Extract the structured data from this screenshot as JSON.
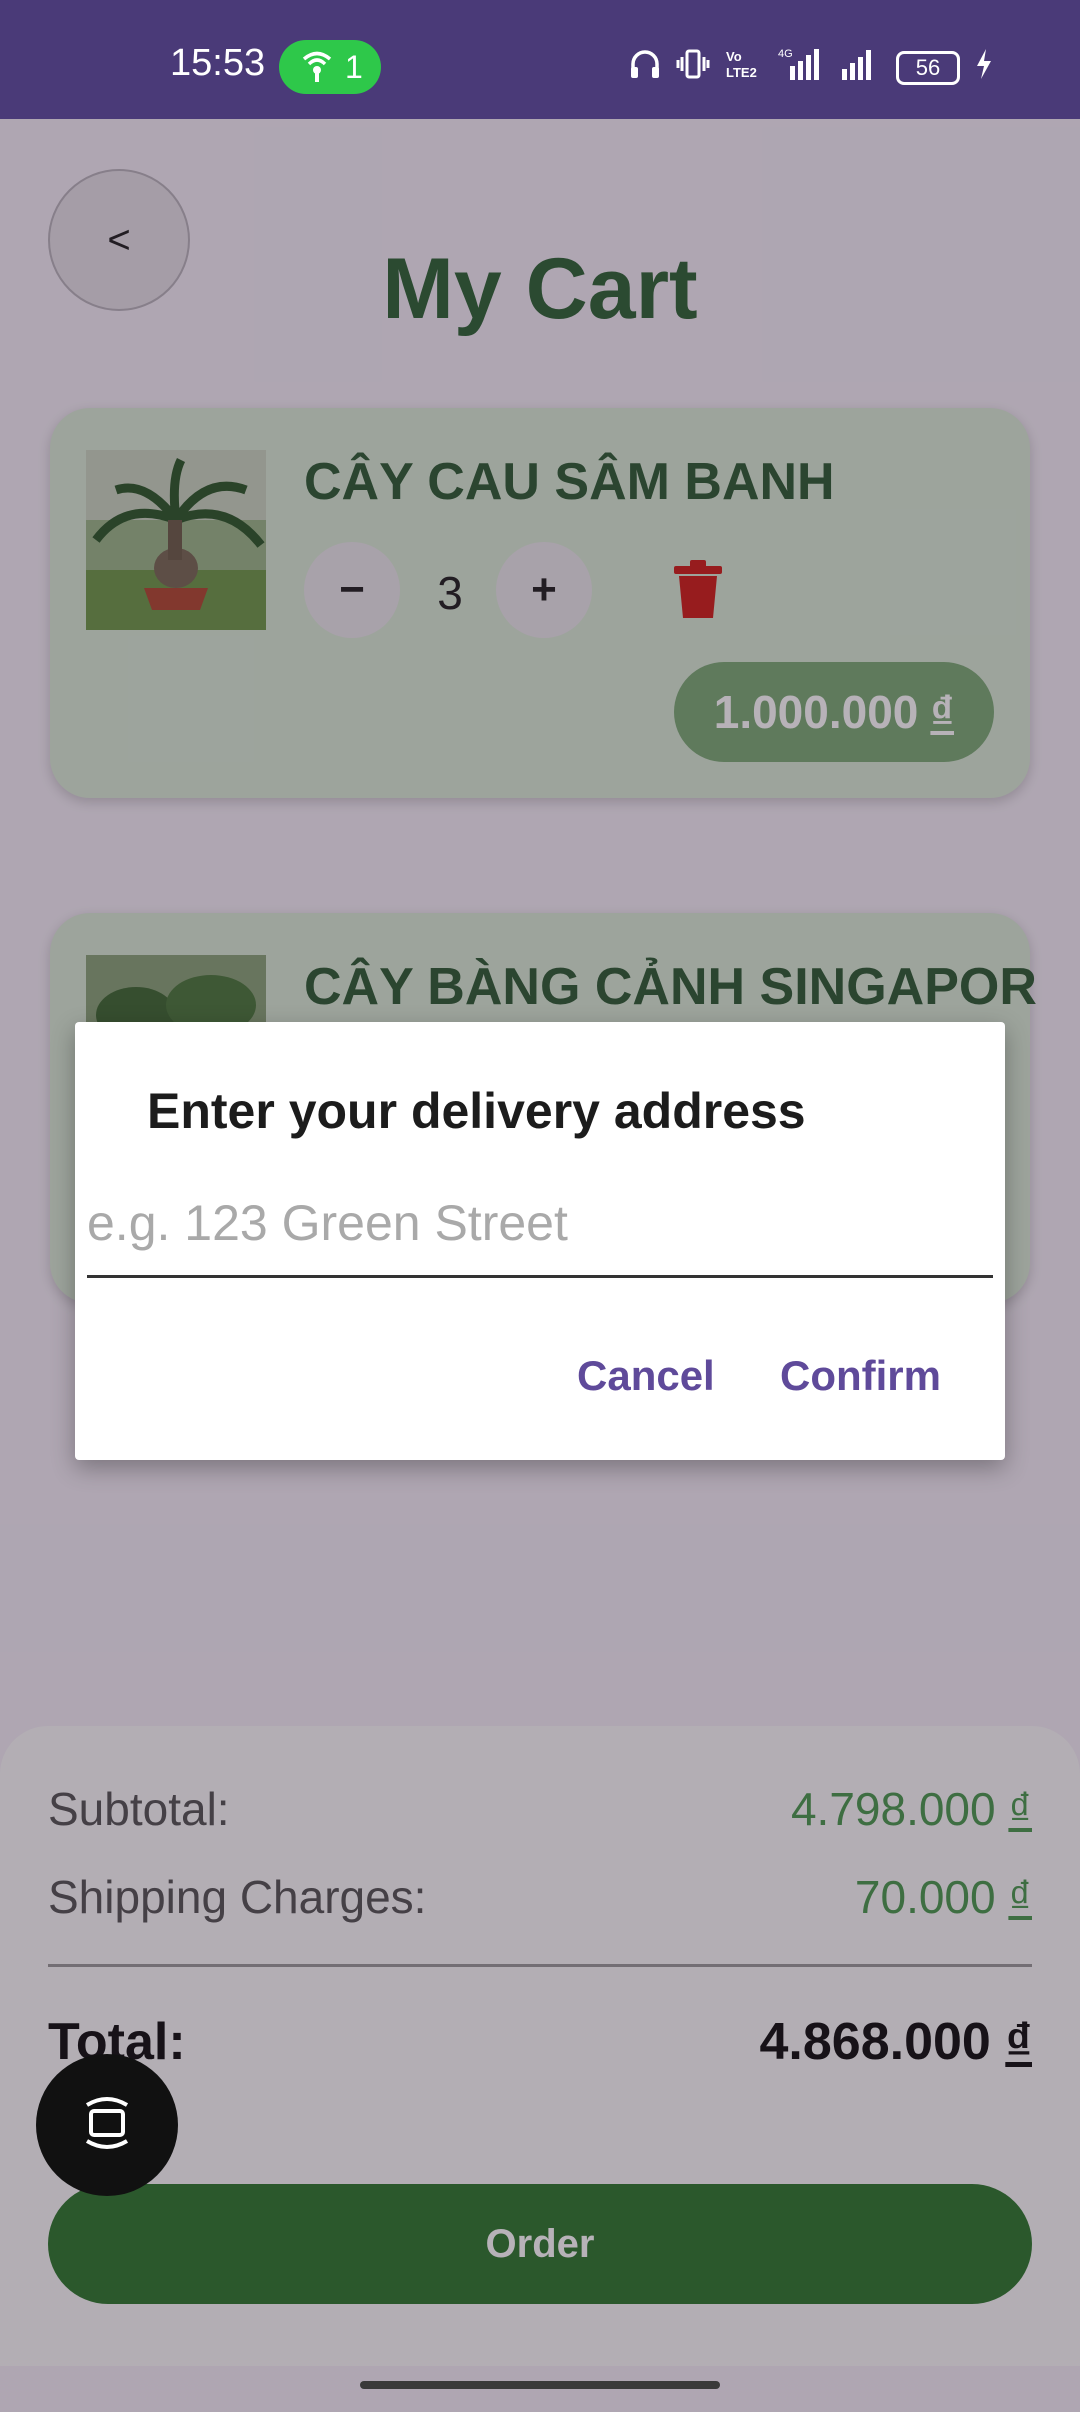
{
  "status_bar": {
    "time": "15:53",
    "hotspot_count": "1",
    "battery": "56"
  },
  "header": {
    "back_label": "<",
    "title": "My Cart"
  },
  "cart": {
    "items": [
      {
        "name": "CÂY CAU SÂM BANH",
        "decrement": "−",
        "quantity": "3",
        "increment": "+",
        "price": "1.000.000",
        "currency": "₫"
      },
      {
        "name": "CÂY BÀNG CẢNH SINGAPOR"
      }
    ]
  },
  "dialog": {
    "title": "Enter your delivery address",
    "placeholder": "e.g. 123 Green Street",
    "value": "",
    "cancel": "Cancel",
    "confirm": "Confirm"
  },
  "summary": {
    "subtotal_label": "Subtotal:",
    "subtotal_value": "4.798.000",
    "shipping_label": "Shipping Charges:",
    "shipping_value": "70.000",
    "total_label": "Total:",
    "total_value": "4.868.000",
    "currency": "₫",
    "order_button": "Order"
  },
  "colors": {
    "accent_green": "#2f7a2f",
    "title_green": "#2f6436",
    "dialog_action": "#5f4a9a",
    "delete_red": "#d0201a",
    "status_bar": "#4a3a78"
  },
  "icons": [
    "headphones-icon",
    "vibrate-icon",
    "volte-icon",
    "signal-icon",
    "battery-icon",
    "charging-icon",
    "trash-icon",
    "screen-toggle-icon"
  ]
}
